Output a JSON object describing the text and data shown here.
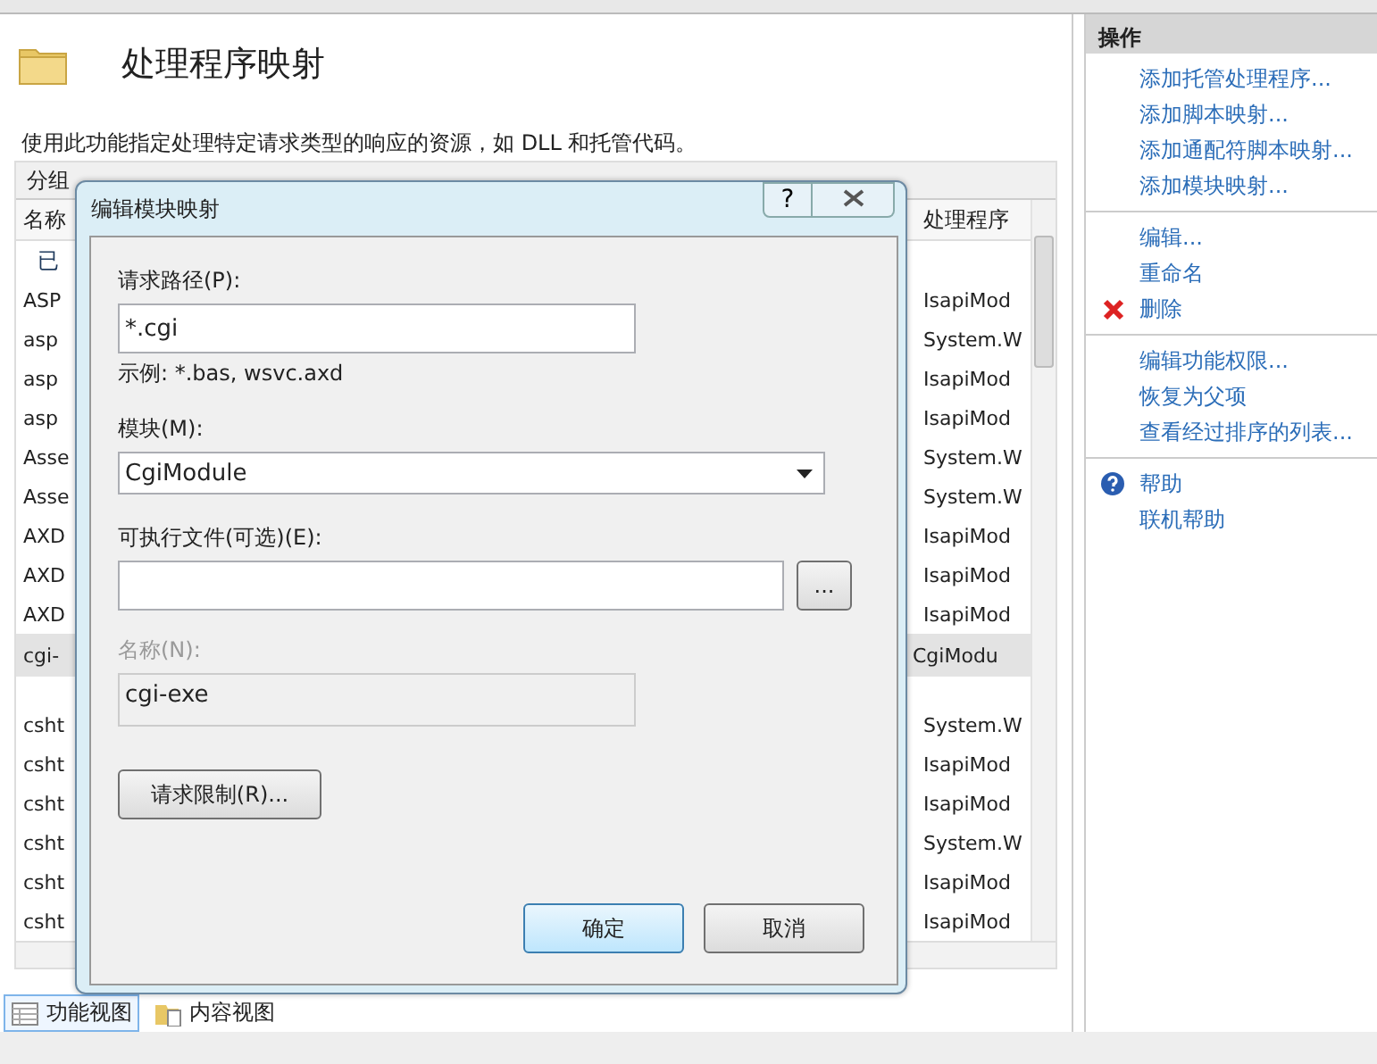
{
  "page": {
    "title": "处理程序映射",
    "description": "使用此功能指定处理特定请求类型的响应的资源，如 DLL 和托管代码。",
    "group_by_label": "分组",
    "columns": [
      "名称",
      "处理程序"
    ],
    "group": "已",
    "rows": [
      {
        "name": "ASP",
        "handler": "IsapiMod",
        "selected": false
      },
      {
        "name": "asp",
        "handler": "System.W",
        "selected": false
      },
      {
        "name": "asp",
        "handler": "IsapiMod",
        "selected": false
      },
      {
        "name": "asp",
        "handler": "IsapiMod",
        "selected": false
      },
      {
        "name": "Asse",
        "handler": "System.W",
        "selected": false
      },
      {
        "name": "Asse",
        "handler": "System.W",
        "selected": false
      },
      {
        "name": "AXD",
        "handler": "IsapiMod",
        "selected": false
      },
      {
        "name": "AXD",
        "handler": "IsapiMod",
        "selected": false
      },
      {
        "name": "AXD",
        "handler": "IsapiMod",
        "selected": false
      },
      {
        "name": "cgi-",
        "handler": "CgiModu",
        "selected": true
      },
      {
        "name": "csht",
        "handler": "System.W",
        "selected": false
      },
      {
        "name": "csht",
        "handler": "IsapiMod",
        "selected": false
      },
      {
        "name": "csht",
        "handler": "IsapiMod",
        "selected": false
      },
      {
        "name": "csht",
        "handler": "System.W",
        "selected": false
      },
      {
        "name": "csht",
        "handler": "IsapiMod",
        "selected": false
      },
      {
        "name": "csht",
        "handler": "IsapiMod",
        "selected": false
      }
    ],
    "view_tabs": [
      {
        "label": "功能视图",
        "kind": "features",
        "selected": true
      },
      {
        "label": "内容视图",
        "kind": "content",
        "selected": false
      }
    ]
  },
  "actions": {
    "title": "操作",
    "groups": [
      [
        {
          "label": "添加托管处理程序...",
          "kind": "plain"
        },
        {
          "label": "添加脚本映射...",
          "kind": "plain"
        },
        {
          "label": "添加通配符脚本映射...",
          "kind": "plain"
        },
        {
          "label": "添加模块映射...",
          "kind": "plain"
        }
      ],
      [
        {
          "label": "编辑...",
          "kind": "plain"
        },
        {
          "label": "重命名",
          "kind": "plain"
        },
        {
          "label": "删除",
          "kind": "delete"
        }
      ],
      [
        {
          "label": "编辑功能权限...",
          "kind": "plain"
        },
        {
          "label": "恢复为父项",
          "kind": "plain"
        },
        {
          "label": "查看经过排序的列表...",
          "kind": "plain"
        }
      ],
      [
        {
          "label": "帮助",
          "kind": "help"
        },
        {
          "label": "联机帮助",
          "kind": "plain"
        }
      ]
    ]
  },
  "dialog": {
    "title": "编辑模块映射",
    "help_button": "?",
    "request_path": {
      "label": "请求路径(P):",
      "value": "*.cgi",
      "example": "示例: *.bas, wsvc.axd"
    },
    "module": {
      "label": "模块(M):",
      "value": "CgiModule"
    },
    "executable": {
      "label": "可执行文件(可选)(E):",
      "browse_button": "..."
    },
    "name": {
      "label": "名称(N):",
      "value": "cgi-exe",
      "disabled": true
    },
    "restrictions_button": "请求限制(R)...",
    "ok_button": "确定",
    "cancel_button": "取消"
  }
}
